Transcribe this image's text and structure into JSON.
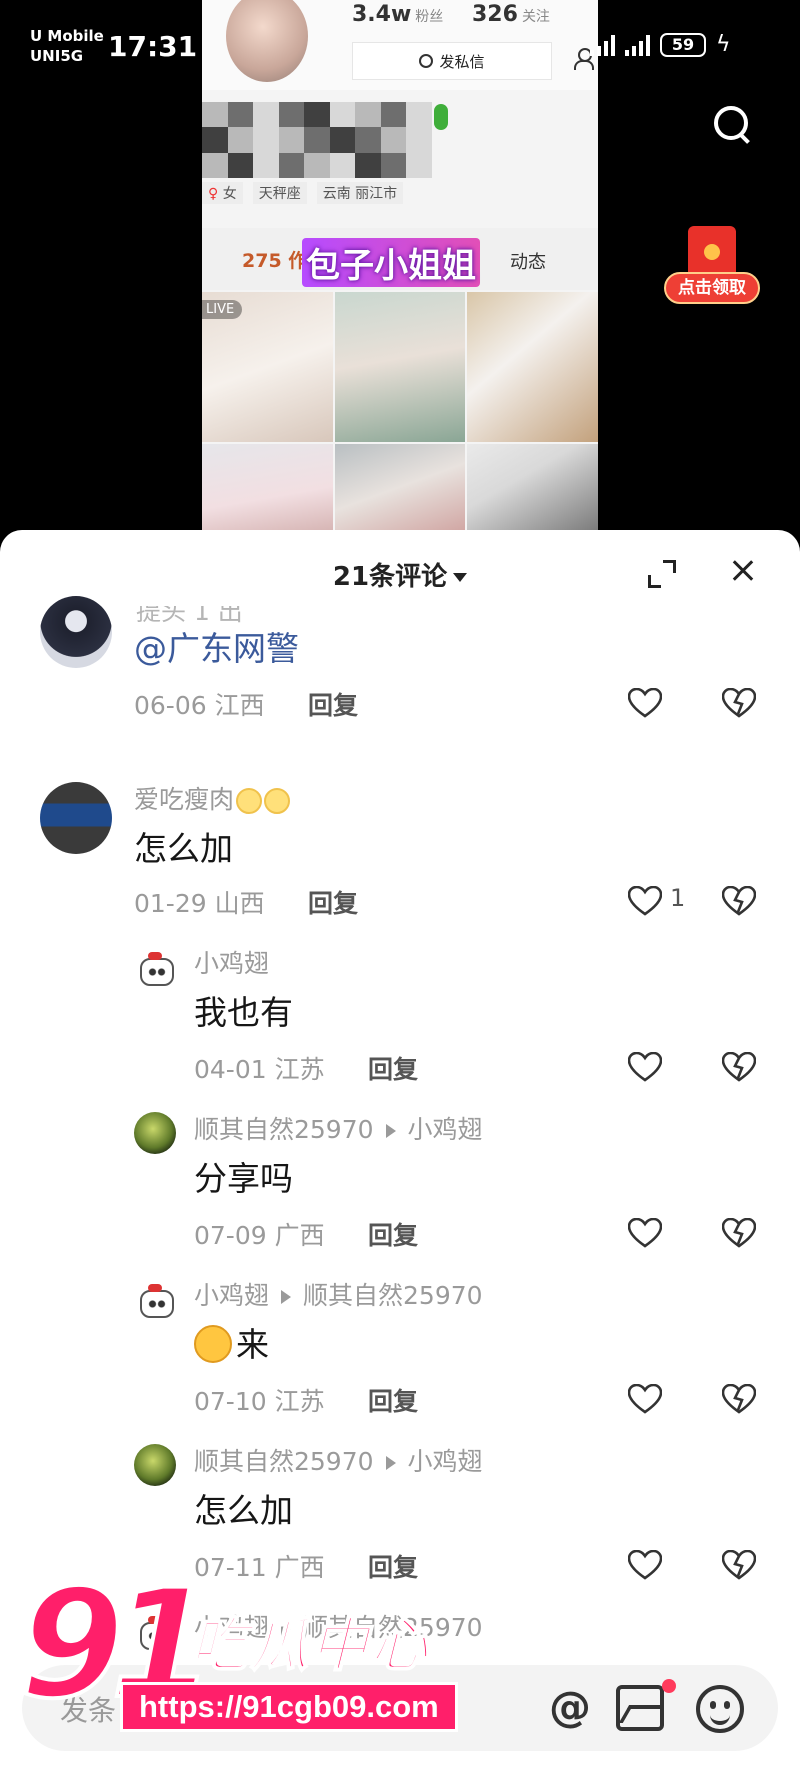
{
  "status_bar": {
    "carrier_line1": "U Mobile",
    "carrier_line2": "UNI5G",
    "time": "17:31",
    "battery": "59"
  },
  "video": {
    "profile": {
      "fans_count": "3.4w",
      "fans_label": "粉丝",
      "follow_count": "326",
      "follow_label": "关注",
      "message_button": "发私信",
      "gender": "女",
      "zodiac": "天秤座",
      "location": "云南 丽江市",
      "works_label": "275 作",
      "dynamics_label": "动态",
      "live_badge": "LIVE"
    },
    "overlay_caption": "包子小姐姐",
    "red_packet_label": "点击领取",
    "icons": [
      "search-icon",
      "red-packet-icon"
    ]
  },
  "comments_sheet": {
    "title": "21条评论",
    "reply_label": "回复",
    "comments": [
      {
        "name_partial": "提头 1 出",
        "text": "@广东网警",
        "date": "06-06",
        "region": "江西",
        "likes": ""
      },
      {
        "name": "爱吃瘦肉",
        "text": "怎么加",
        "date": "01-29",
        "region": "山西",
        "likes": "1"
      },
      {
        "name": "小鸡翅",
        "text": "我也有",
        "date": "04-01",
        "region": "江苏",
        "likes": ""
      },
      {
        "name": "顺其自然25970",
        "reply_to": "小鸡翅",
        "text": "分享吗",
        "date": "07-09",
        "region": "广西",
        "likes": ""
      },
      {
        "name": "小鸡翅",
        "reply_to": "顺其自然25970",
        "text": "来",
        "date": "07-10",
        "region": "江苏",
        "likes": ""
      },
      {
        "name": "顺其自然25970",
        "reply_to": "小鸡翅",
        "text": "怎么加",
        "date": "07-11",
        "region": "广西",
        "likes": ""
      },
      {
        "name": "小鸡翅",
        "reply_to": "顺其自然25970"
      }
    ]
  },
  "input_bar": {
    "placeholder": "发条",
    "icons": [
      "at-icon",
      "image-icon",
      "emoji-icon"
    ]
  },
  "watermark": {
    "number": "91",
    "title": "吃瓜中心",
    "url": "https://91cgb09.com"
  }
}
